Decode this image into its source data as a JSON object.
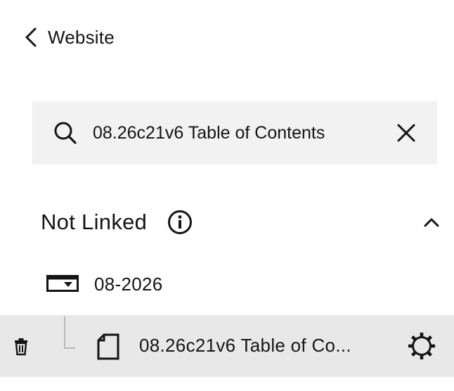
{
  "header": {
    "back_label": "Website",
    "back_icon": "chevron-left-icon"
  },
  "search": {
    "value": "08.26c21v6 Table of Contents",
    "icon": "search-icon",
    "clear_icon": "close-icon"
  },
  "section": {
    "label": "Not Linked",
    "info_icon": "info-icon",
    "toggle_icon": "chevron-up-icon"
  },
  "tree": {
    "folder": {
      "name": "08-2026",
      "icon": "folder-dropdown-icon"
    },
    "page": {
      "title": "08.26c21v6 Table of Co...",
      "icon": "page-icon",
      "delete_icon": "trash-icon",
      "settings_icon": "gear-icon"
    }
  },
  "colors": {
    "text": "#141414",
    "search_bg": "#f2f2f2",
    "selected_row_bg": "#e8e8e8",
    "tree_line": "#b7b7b7"
  }
}
